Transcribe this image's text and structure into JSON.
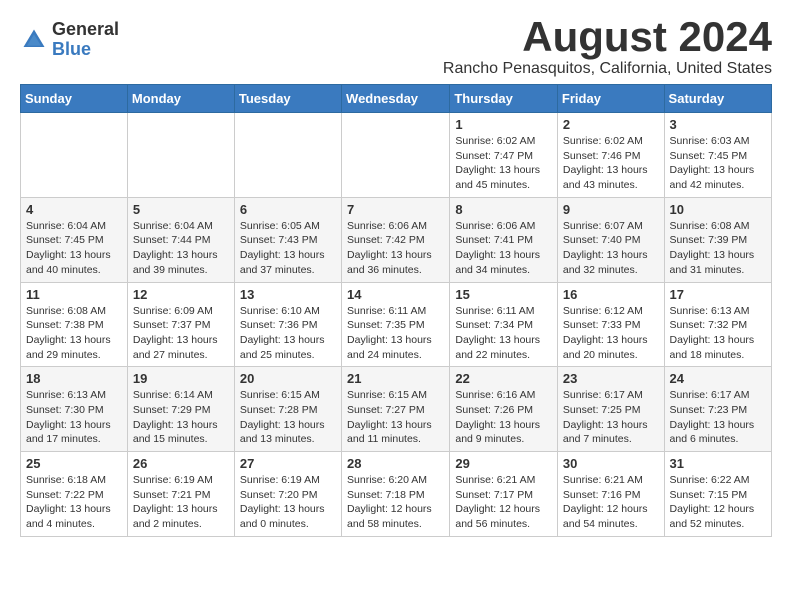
{
  "header": {
    "logo_general": "General",
    "logo_blue": "Blue",
    "month_year": "August 2024",
    "location": "Rancho Penasquitos, California, United States"
  },
  "weekdays": [
    "Sunday",
    "Monday",
    "Tuesday",
    "Wednesday",
    "Thursday",
    "Friday",
    "Saturday"
  ],
  "weeks": [
    [
      {
        "day": "",
        "info": ""
      },
      {
        "day": "",
        "info": ""
      },
      {
        "day": "",
        "info": ""
      },
      {
        "day": "",
        "info": ""
      },
      {
        "day": "1",
        "info": "Sunrise: 6:02 AM\nSunset: 7:47 PM\nDaylight: 13 hours\nand 45 minutes."
      },
      {
        "day": "2",
        "info": "Sunrise: 6:02 AM\nSunset: 7:46 PM\nDaylight: 13 hours\nand 43 minutes."
      },
      {
        "day": "3",
        "info": "Sunrise: 6:03 AM\nSunset: 7:45 PM\nDaylight: 13 hours\nand 42 minutes."
      }
    ],
    [
      {
        "day": "4",
        "info": "Sunrise: 6:04 AM\nSunset: 7:45 PM\nDaylight: 13 hours\nand 40 minutes."
      },
      {
        "day": "5",
        "info": "Sunrise: 6:04 AM\nSunset: 7:44 PM\nDaylight: 13 hours\nand 39 minutes."
      },
      {
        "day": "6",
        "info": "Sunrise: 6:05 AM\nSunset: 7:43 PM\nDaylight: 13 hours\nand 37 minutes."
      },
      {
        "day": "7",
        "info": "Sunrise: 6:06 AM\nSunset: 7:42 PM\nDaylight: 13 hours\nand 36 minutes."
      },
      {
        "day": "8",
        "info": "Sunrise: 6:06 AM\nSunset: 7:41 PM\nDaylight: 13 hours\nand 34 minutes."
      },
      {
        "day": "9",
        "info": "Sunrise: 6:07 AM\nSunset: 7:40 PM\nDaylight: 13 hours\nand 32 minutes."
      },
      {
        "day": "10",
        "info": "Sunrise: 6:08 AM\nSunset: 7:39 PM\nDaylight: 13 hours\nand 31 minutes."
      }
    ],
    [
      {
        "day": "11",
        "info": "Sunrise: 6:08 AM\nSunset: 7:38 PM\nDaylight: 13 hours\nand 29 minutes."
      },
      {
        "day": "12",
        "info": "Sunrise: 6:09 AM\nSunset: 7:37 PM\nDaylight: 13 hours\nand 27 minutes."
      },
      {
        "day": "13",
        "info": "Sunrise: 6:10 AM\nSunset: 7:36 PM\nDaylight: 13 hours\nand 25 minutes."
      },
      {
        "day": "14",
        "info": "Sunrise: 6:11 AM\nSunset: 7:35 PM\nDaylight: 13 hours\nand 24 minutes."
      },
      {
        "day": "15",
        "info": "Sunrise: 6:11 AM\nSunset: 7:34 PM\nDaylight: 13 hours\nand 22 minutes."
      },
      {
        "day": "16",
        "info": "Sunrise: 6:12 AM\nSunset: 7:33 PM\nDaylight: 13 hours\nand 20 minutes."
      },
      {
        "day": "17",
        "info": "Sunrise: 6:13 AM\nSunset: 7:32 PM\nDaylight: 13 hours\nand 18 minutes."
      }
    ],
    [
      {
        "day": "18",
        "info": "Sunrise: 6:13 AM\nSunset: 7:30 PM\nDaylight: 13 hours\nand 17 minutes."
      },
      {
        "day": "19",
        "info": "Sunrise: 6:14 AM\nSunset: 7:29 PM\nDaylight: 13 hours\nand 15 minutes."
      },
      {
        "day": "20",
        "info": "Sunrise: 6:15 AM\nSunset: 7:28 PM\nDaylight: 13 hours\nand 13 minutes."
      },
      {
        "day": "21",
        "info": "Sunrise: 6:15 AM\nSunset: 7:27 PM\nDaylight: 13 hours\nand 11 minutes."
      },
      {
        "day": "22",
        "info": "Sunrise: 6:16 AM\nSunset: 7:26 PM\nDaylight: 13 hours\nand 9 minutes."
      },
      {
        "day": "23",
        "info": "Sunrise: 6:17 AM\nSunset: 7:25 PM\nDaylight: 13 hours\nand 7 minutes."
      },
      {
        "day": "24",
        "info": "Sunrise: 6:17 AM\nSunset: 7:23 PM\nDaylight: 13 hours\nand 6 minutes."
      }
    ],
    [
      {
        "day": "25",
        "info": "Sunrise: 6:18 AM\nSunset: 7:22 PM\nDaylight: 13 hours\nand 4 minutes."
      },
      {
        "day": "26",
        "info": "Sunrise: 6:19 AM\nSunset: 7:21 PM\nDaylight: 13 hours\nand 2 minutes."
      },
      {
        "day": "27",
        "info": "Sunrise: 6:19 AM\nSunset: 7:20 PM\nDaylight: 13 hours\nand 0 minutes."
      },
      {
        "day": "28",
        "info": "Sunrise: 6:20 AM\nSunset: 7:18 PM\nDaylight: 12 hours\nand 58 minutes."
      },
      {
        "day": "29",
        "info": "Sunrise: 6:21 AM\nSunset: 7:17 PM\nDaylight: 12 hours\nand 56 minutes."
      },
      {
        "day": "30",
        "info": "Sunrise: 6:21 AM\nSunset: 7:16 PM\nDaylight: 12 hours\nand 54 minutes."
      },
      {
        "day": "31",
        "info": "Sunrise: 6:22 AM\nSunset: 7:15 PM\nDaylight: 12 hours\nand 52 minutes."
      }
    ]
  ]
}
